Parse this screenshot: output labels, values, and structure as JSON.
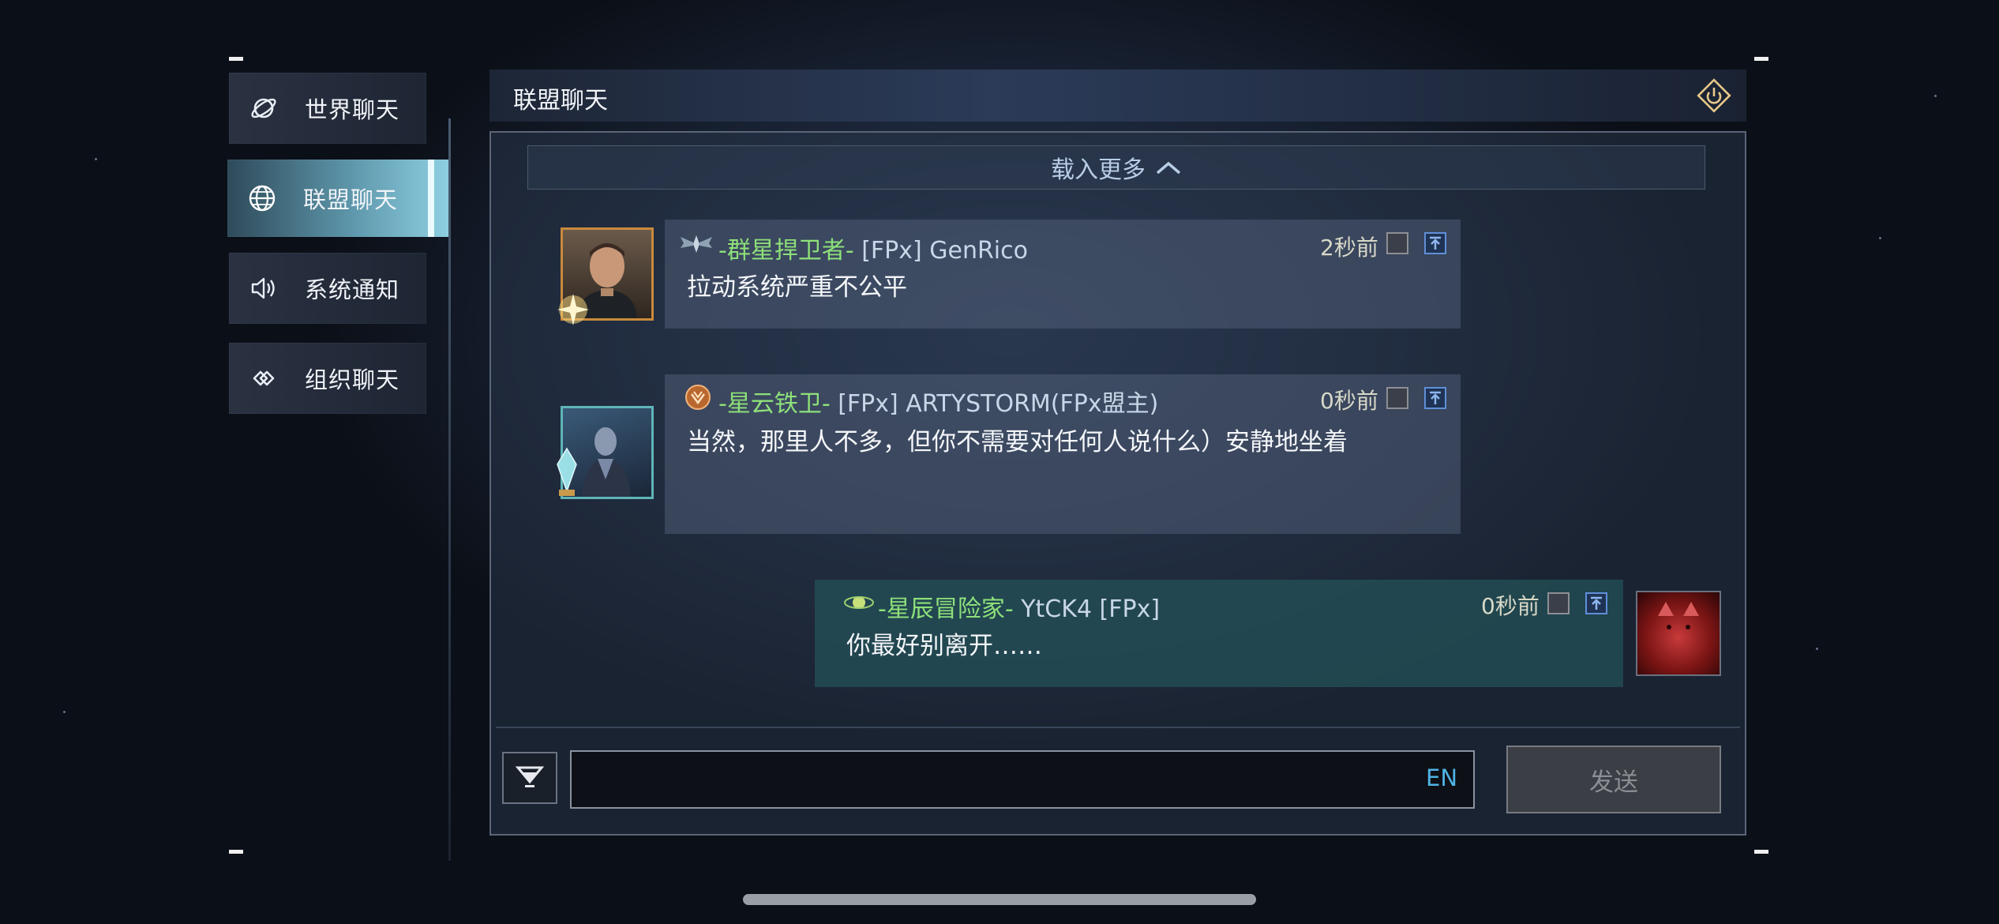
{
  "sidebar": {
    "items": [
      {
        "label": "世界聊天",
        "icon": "planet-icon",
        "active": false
      },
      {
        "label": "联盟聊天",
        "icon": "globe-icon",
        "active": true
      },
      {
        "label": "系统通知",
        "icon": "speaker-icon",
        "active": false
      },
      {
        "label": "组织聊天",
        "icon": "link-icon",
        "active": false
      }
    ]
  },
  "header": {
    "title": "联盟聊天",
    "icon": "power-icon"
  },
  "load_more": {
    "label": "载入更多"
  },
  "messages": [
    {
      "rank": "-群星捍卫者-",
      "player": "[FPx] GenRico",
      "time": "2秒前",
      "text": "拉动系统严重不公平"
    },
    {
      "rank": "-星云铁卫-",
      "player": "[FPx] ARTYSTORM(FPx盟主)",
      "time": "0秒前",
      "text": "当然，那里人不多，但你不需要对任何人说什么）安静地坐着"
    },
    {
      "rank": "-星辰冒险家-",
      "player": "YtCK4 [FPx]",
      "time": "0秒前",
      "text": "你最好别离开……"
    }
  ],
  "input": {
    "value": "",
    "placeholder": "",
    "lang_label": "EN"
  },
  "send": {
    "label": "发送"
  },
  "colors": {
    "rank_green": "#8ee07a",
    "send_disabled": "#3b3e44",
    "accent_cyan": "#8fd0e2",
    "lang_blue": "#4fb4e4"
  }
}
